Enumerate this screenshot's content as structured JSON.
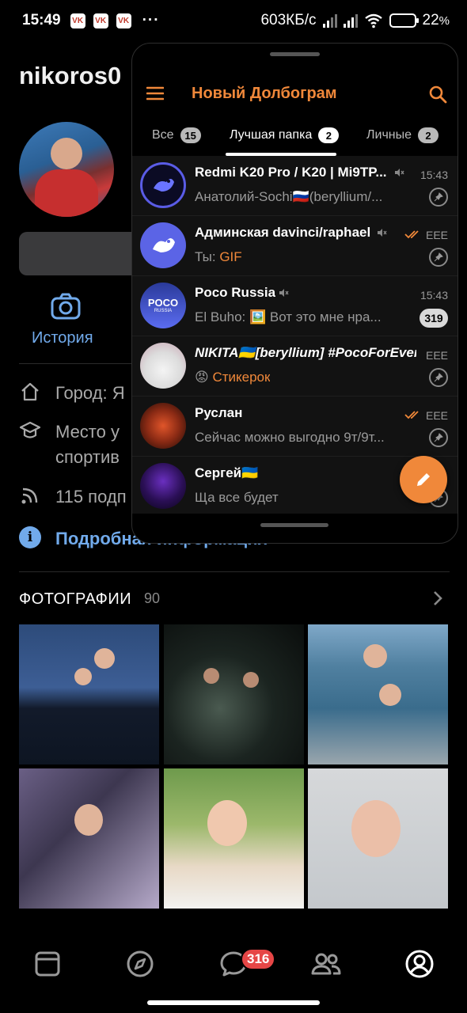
{
  "status_bar": {
    "time": "15:49",
    "more": "···",
    "speed": "603КБ/с",
    "battery": "22",
    "battery_unit": "%",
    "battery_level": 0.22,
    "notif_label": "VK"
  },
  "profile": {
    "name": "nikoros0",
    "story_label": "История",
    "info": {
      "city": "Город: Я",
      "place_line1": "Место у",
      "place_line2": "спортив",
      "followers": "115 подп",
      "more_details": "Подробная информация"
    },
    "photos_title": "ФОТОГРАФИИ",
    "photos_count": "90"
  },
  "bottom_nav": {
    "items": [
      "feed",
      "discover",
      "messages",
      "friends",
      "profile"
    ],
    "messages_badge": "316"
  },
  "popup": {
    "title": "Новый Долбограм",
    "tabs": [
      {
        "label": "Все",
        "count": "15"
      },
      {
        "label": "Лучшая папка",
        "count": "2"
      },
      {
        "label": "Личные",
        "count": "2"
      }
    ],
    "active_tab": 1,
    "chats": [
      {
        "name": "Redmi K20 Pro / K20 | Mi9TP...",
        "time": "15:43",
        "preview": "Анатолий-Sochi🇷🇺(beryllium/...",
        "muted": true,
        "pinned": true
      },
      {
        "name": "Админская davinci/raphael",
        "time": "ЕЕЕ",
        "preview_prefix": "Ты: ",
        "preview_highlight": "GIF",
        "muted": true,
        "pinned": true,
        "read": true
      },
      {
        "name": "Poco Russia",
        "time": "15:43",
        "preview": "El Buho: 🖼️ Вот это мне нра...",
        "muted": true,
        "unread": "319"
      },
      {
        "name": "NIKITA🇺🇦[beryllium] #PocoForEver",
        "time": "ЕЕЕ",
        "preview_prefix": "😡 ",
        "preview_highlight": "Стикерок",
        "pinned": true
      },
      {
        "name": "Руслан",
        "time": "ЕЕЕ",
        "preview": "Сейчас можно выгодно 9т/9т...",
        "pinned": true,
        "read": true
      },
      {
        "name": "Сергей🇺🇦",
        "time": "",
        "preview": "Ща все будет",
        "pinned": true
      }
    ],
    "avatar_labels": {
      "poco": "POCO",
      "poco_sub": "RUSSIA"
    },
    "colors": {
      "accent": "#f0883a",
      "link": "#71aaeb",
      "badge": "#e64646"
    }
  }
}
